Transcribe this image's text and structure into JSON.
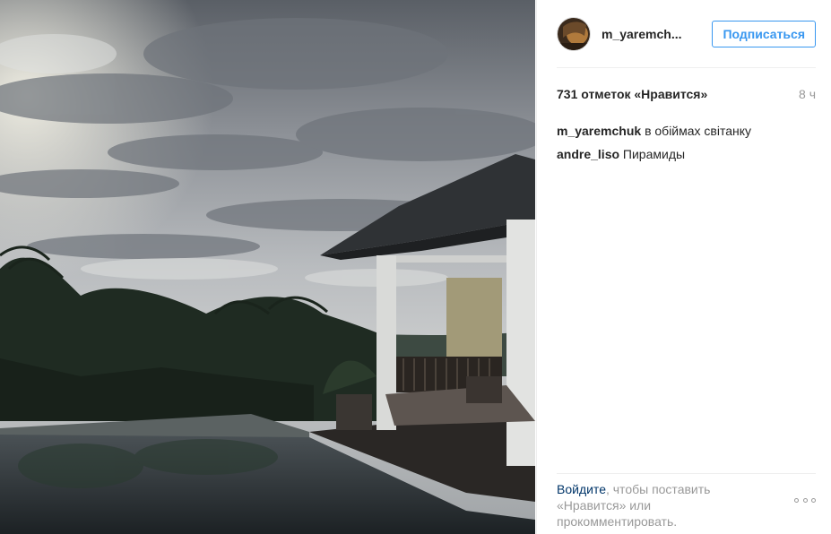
{
  "post": {
    "image_alt": "",
    "header": {
      "username": "m_yaremch...",
      "follow_label": "Подписаться"
    },
    "likes": "731 отметок «Нравится»",
    "time": "8 ч",
    "comments": [
      {
        "user": "m_yaremchuk",
        "text": "в обіймах світанку"
      },
      {
        "user": "andre_liso",
        "text": "Пирамиды"
      }
    ],
    "footer": {
      "login_link": "Войдите",
      "login_text": ", чтобы поставить «Нравится» или прокомментировать."
    }
  },
  "colors": {
    "accent": "#3897f0",
    "link": "#003569",
    "muted": "#999999"
  },
  "icons": {
    "more": "more-options-icon"
  }
}
